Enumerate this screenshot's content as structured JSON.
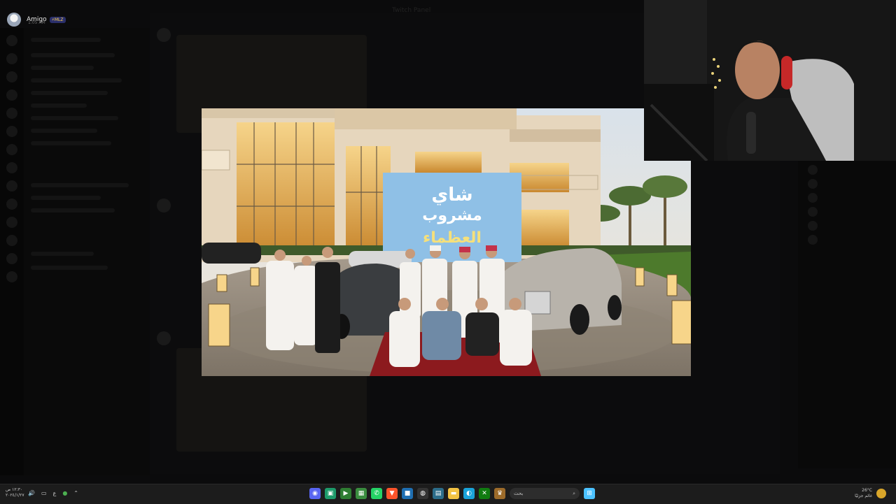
{
  "stream": {
    "name": "Amigo",
    "badge": "⚡MLZ",
    "time": "1:05 AM"
  },
  "background": {
    "title": "Twitch Panel"
  },
  "image": {
    "banner_line1": "شاي",
    "banner_line2": "مشروب",
    "banner_line3": "العظماء"
  },
  "taskbar": {
    "clock_time": "١٢:٣٠ ص",
    "clock_date": "٢٠٢٤/١/٢٧",
    "lang": "ع",
    "search_placeholder": "بحث",
    "weather_temp": "26°C",
    "weather_desc": "غائم جزئيًا",
    "icons": [
      "discord",
      "app",
      "play",
      "grid",
      "whatsapp",
      "brave",
      "square",
      "obs",
      "calendar",
      "folder",
      "edge",
      "xbox",
      "game"
    ],
    "colors": {
      "discord": "#5865f2",
      "whatsapp": "#25d366",
      "brave": "#fb542b",
      "edge": "#1aa3d9",
      "folder": "#f3c343",
      "windows": "#4cc2ff"
    }
  }
}
